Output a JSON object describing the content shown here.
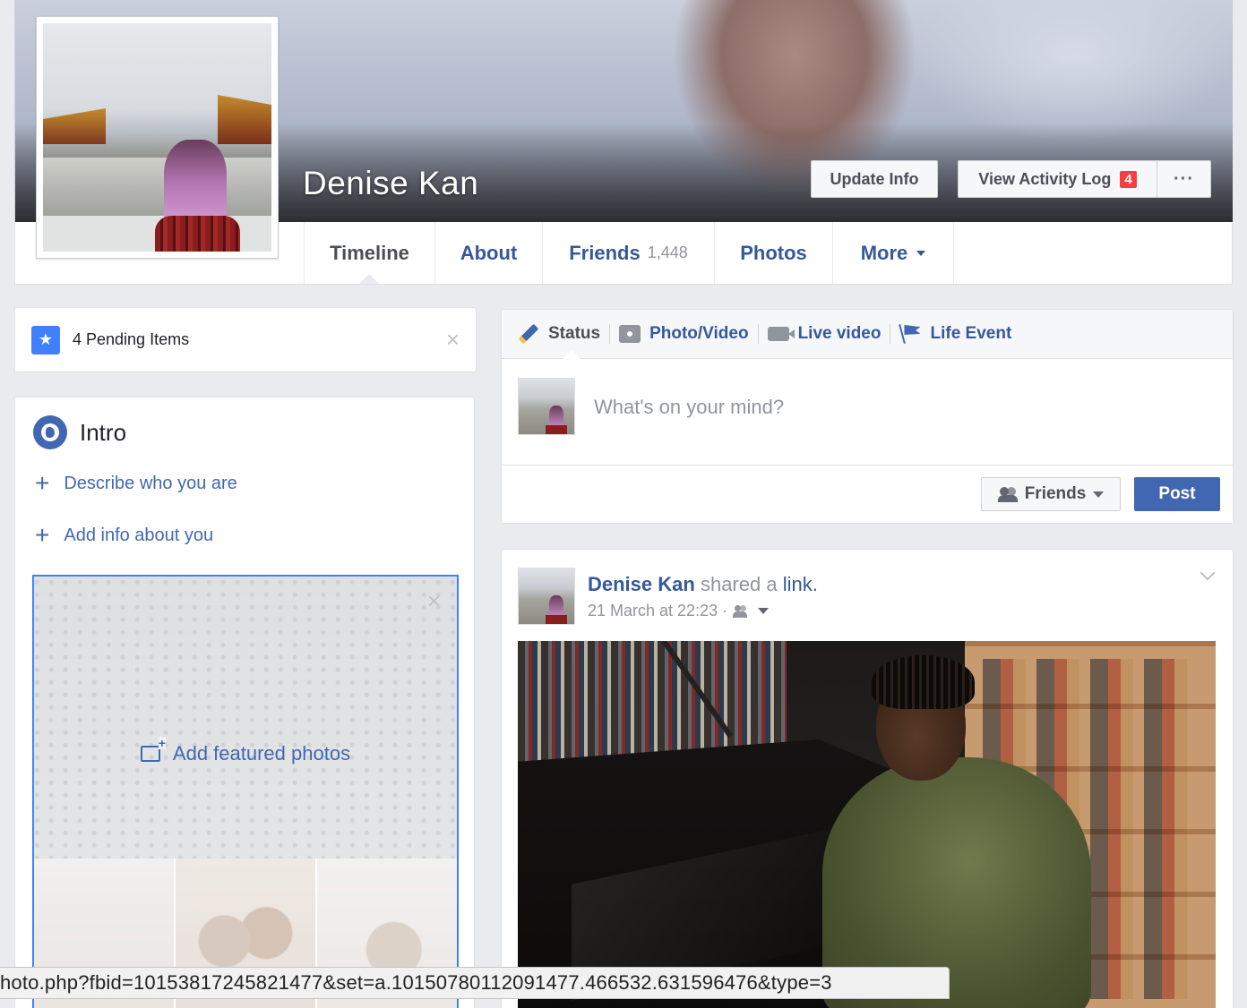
{
  "profile": {
    "name": "Denise Kan",
    "update_info_label": "Update Info",
    "activity_log_label": "View Activity Log",
    "activity_log_badge": "4",
    "more_dots": "···"
  },
  "nav": {
    "timeline": "Timeline",
    "about": "About",
    "friends": "Friends",
    "friends_count": "1,448",
    "photos": "Photos",
    "more": "More"
  },
  "pending": {
    "label": "4 Pending Items",
    "close": "×"
  },
  "intro": {
    "title": "Intro",
    "describe_link": "Describe who you are",
    "add_info_link": "Add info about you",
    "featured_label": "Add featured photos",
    "featured_close": "×",
    "plus": "+"
  },
  "composer": {
    "tab_status": "Status",
    "tab_photo": "Photo/Video",
    "tab_live": "Live video",
    "tab_event": "Life Event",
    "placeholder": "What's on your mind?",
    "audience": "Friends",
    "post_button": "Post"
  },
  "feed": {
    "author": "Denise Kan",
    "action": "shared a",
    "object": "link.",
    "timestamp": "21 March at 22:23 ·"
  },
  "statusbar": {
    "url": "hoto.php?fbid=10153817245821477&set=a.10150780112091477.466532.631596476&type=3"
  },
  "colors": {
    "brand": "#4267b2",
    "link": "#365899",
    "badge": "#fa3e3e",
    "background": "#e9ebee"
  },
  "icons": [
    "star-icon",
    "globe-icon",
    "plus-icon",
    "close-icon",
    "pencil-icon",
    "camera-icon",
    "video-icon",
    "flag-icon",
    "people-icon",
    "caret-down-icon",
    "chevron-down-icon",
    "photo-plus-icon"
  ]
}
